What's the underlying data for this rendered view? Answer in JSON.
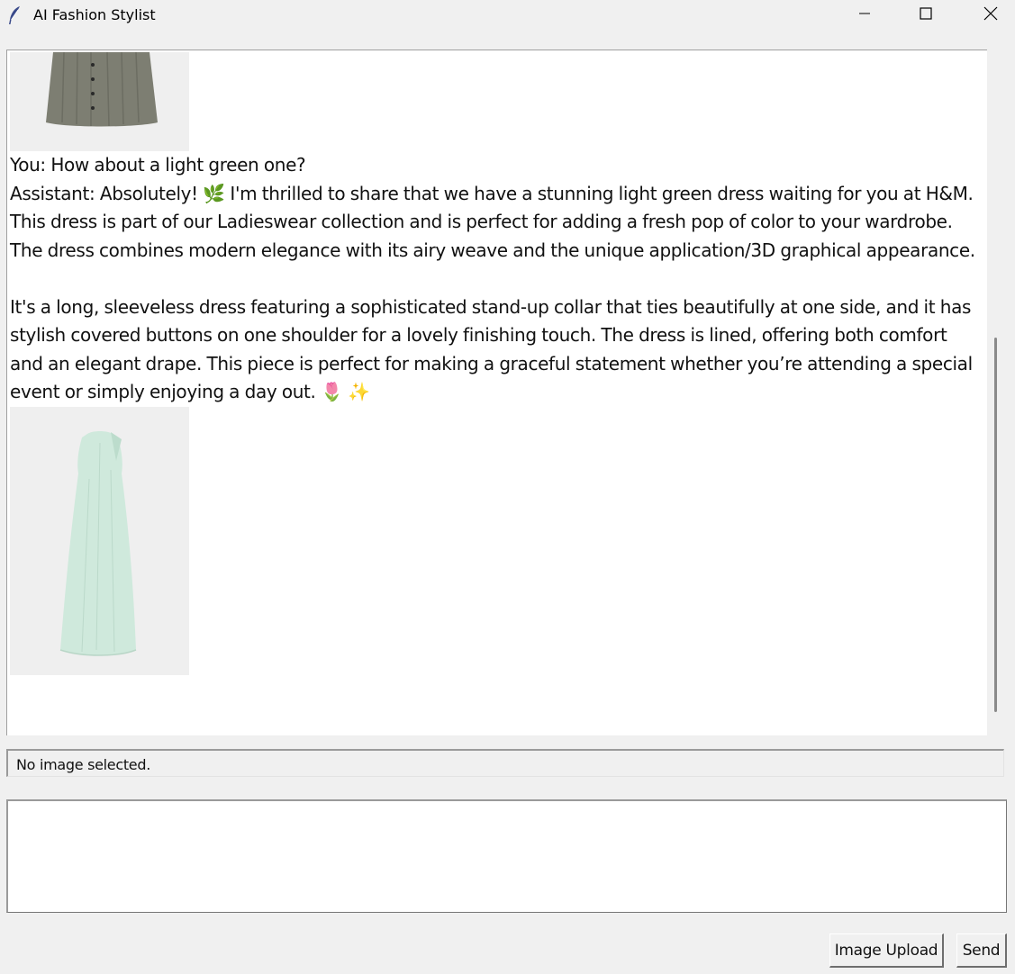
{
  "window": {
    "title": "AI Fashion Stylist",
    "icon": "feather-icon"
  },
  "chat": {
    "messages": [
      {
        "type": "image",
        "alt": "skirt-image",
        "colors": {
          "garment": "#7f8074"
        }
      },
      {
        "type": "text",
        "text": "You: How about a light green one?"
      },
      {
        "type": "text",
        "text": "Assistant: Absolutely! 🌿 I'm thrilled to share that we have a stunning light green dress waiting for you at H&M. This dress is part of our Ladieswear collection and is perfect for adding a fresh pop of color to your wardrobe. The dress combines modern elegance with its airy weave and the unique application/3D graphical appearance."
      },
      {
        "type": "text",
        "text": "It's a long, sleeveless dress featuring a sophisticated stand-up collar that ties beautifully at one side, and it has stylish covered buttons on one shoulder for a lovely finishing touch. The dress is lined, offering both comfort and an elegant drape. This piece is perfect for making a graceful statement whether you’re attending a special event or simply enjoying a day out. 🌷 ✨"
      },
      {
        "type": "image",
        "alt": "dress-image",
        "colors": {
          "garment": "#cfe8da"
        }
      }
    ]
  },
  "status": {
    "text": "No image selected."
  },
  "input": {
    "value": ""
  },
  "buttons": {
    "upload_label": "Image Upload",
    "send_label": "Send"
  },
  "colors": {
    "background": "#f0f0f0",
    "chat_background": "#ffffff",
    "image_background": "#efefef"
  }
}
